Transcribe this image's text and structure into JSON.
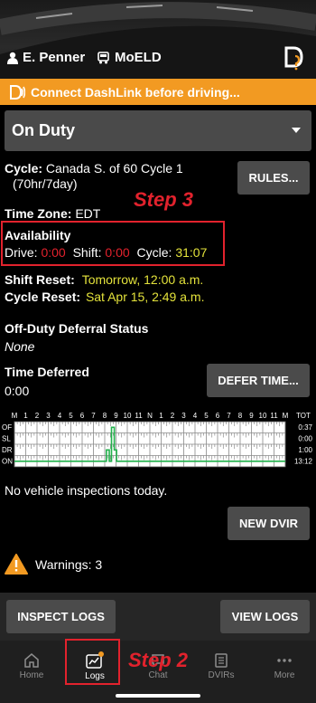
{
  "header": {
    "user_name": "E. Penner",
    "device_name": "MoELD"
  },
  "banner": {
    "text": "Connect DashLink before driving..."
  },
  "duty_status": {
    "selected": "On Duty"
  },
  "cycle": {
    "label": "Cycle:",
    "value": "Canada S. of 60 Cycle 1",
    "detail": "(70hr/7day)",
    "rules_button": "RULES..."
  },
  "annotations": {
    "step3": "Step 3",
    "step2": "Step 2"
  },
  "time_zone": {
    "label": "Time Zone:",
    "value": "EDT"
  },
  "availability": {
    "title": "Availability",
    "drive_label": "Drive:",
    "drive_value": "0:00",
    "shift_label": "Shift:",
    "shift_value": "0:00",
    "cycle_label": "Cycle:",
    "cycle_value": "31:07"
  },
  "resets": {
    "shift_label": "Shift Reset:",
    "shift_value": "Tomorrow, 12:00 a.m.",
    "cycle_label": "Cycle Reset:",
    "cycle_value": "Sat Apr 15, 2:49 a.m."
  },
  "deferral": {
    "title": "Off-Duty Deferral Status",
    "value": "None"
  },
  "deferred": {
    "title": "Time Deferred",
    "value": "0:00",
    "button": "DEFER TIME..."
  },
  "log_grid": {
    "hours": [
      "M",
      "1",
      "2",
      "3",
      "4",
      "5",
      "6",
      "7",
      "8",
      "9",
      "10",
      "11",
      "N",
      "1",
      "2",
      "3",
      "4",
      "5",
      "6",
      "7",
      "8",
      "9",
      "10",
      "11",
      "M"
    ],
    "rows": [
      {
        "label": "OF",
        "total": "0:37"
      },
      {
        "label": "SL",
        "total": "0:00"
      },
      {
        "label": "DR",
        "total": "1:00"
      },
      {
        "label": "ON",
        "total": "13:12"
      }
    ],
    "total_header": "TOT"
  },
  "inspections": {
    "text": "No vehicle inspections today.",
    "button": "NEW DVIR"
  },
  "warnings": {
    "text": "Warnings: 3"
  },
  "actions": {
    "inspect": "INSPECT LOGS",
    "view": "VIEW LOGS"
  },
  "nav": {
    "items": [
      {
        "label": "Home"
      },
      {
        "label": "Logs"
      },
      {
        "label": "Chat"
      },
      {
        "label": "DVIRs"
      },
      {
        "label": "More"
      }
    ]
  },
  "colors": {
    "accent": "#f29a22",
    "alert": "#e2222d",
    "highlight": "#e3e23b"
  }
}
